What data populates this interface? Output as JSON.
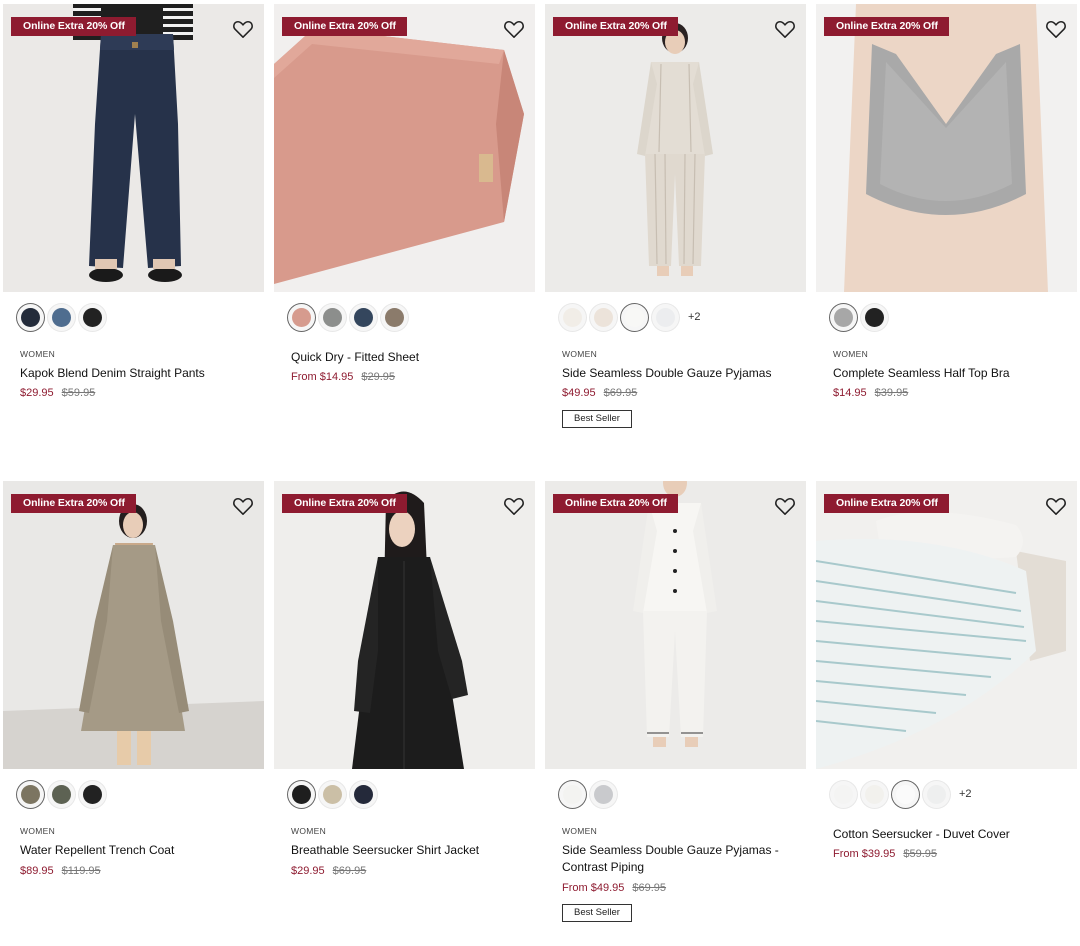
{
  "badge_text": "Online Extra 20% Off",
  "colors": {
    "sale": "#8e1b30",
    "badge_bg": "#8e1b30"
  },
  "products": [
    {
      "category": "WOMEN",
      "name": "Kapok Blend Denim Straight Pants",
      "price": "$29.95",
      "was": "$59.95",
      "swatches": [
        "dark indigo",
        "blue",
        "black"
      ]
    },
    {
      "category": "",
      "name": "Quick Dry - Fitted Sheet",
      "price": "From $14.95",
      "was": "$29.95",
      "swatches": [
        "pink",
        "grey",
        "navy",
        "brown"
      ]
    },
    {
      "category": "WOMEN",
      "name": "Side Seamless Double Gauze Pyjamas",
      "price": "$49.95",
      "was": "$69.95",
      "swatches": [
        "ecru",
        "beige",
        "white",
        "light grey"
      ],
      "more": "+2",
      "tag": "Best Seller"
    },
    {
      "category": "WOMEN",
      "name": "Complete Seamless Half Top Bra",
      "price": "$14.95",
      "was": "$39.95",
      "swatches": [
        "grey",
        "black"
      ]
    },
    {
      "category": "WOMEN",
      "name": "Water Repellent Trench Coat",
      "price": "$89.95",
      "was": "$119.95",
      "swatches": [
        "beige",
        "khaki",
        "black"
      ]
    },
    {
      "category": "WOMEN",
      "name": "Breathable Seersucker Shirt Jacket",
      "price": "$29.95",
      "was": "$69.95",
      "swatches": [
        "black",
        "beige",
        "navy"
      ]
    },
    {
      "category": "WOMEN",
      "name": "Side Seamless Double Gauze Pyjamas - Contrast Piping",
      "price": "From $49.95",
      "was": "$69.95",
      "swatches": [
        "white",
        "grey"
      ],
      "tag": "Best Seller"
    },
    {
      "category": "",
      "name": "Cotton Seersucker - Duvet Cover",
      "price": "From $39.95",
      "was": "$59.95",
      "swatches": [
        "white",
        "ivory",
        "white",
        "light grey"
      ],
      "more": "+2"
    }
  ]
}
